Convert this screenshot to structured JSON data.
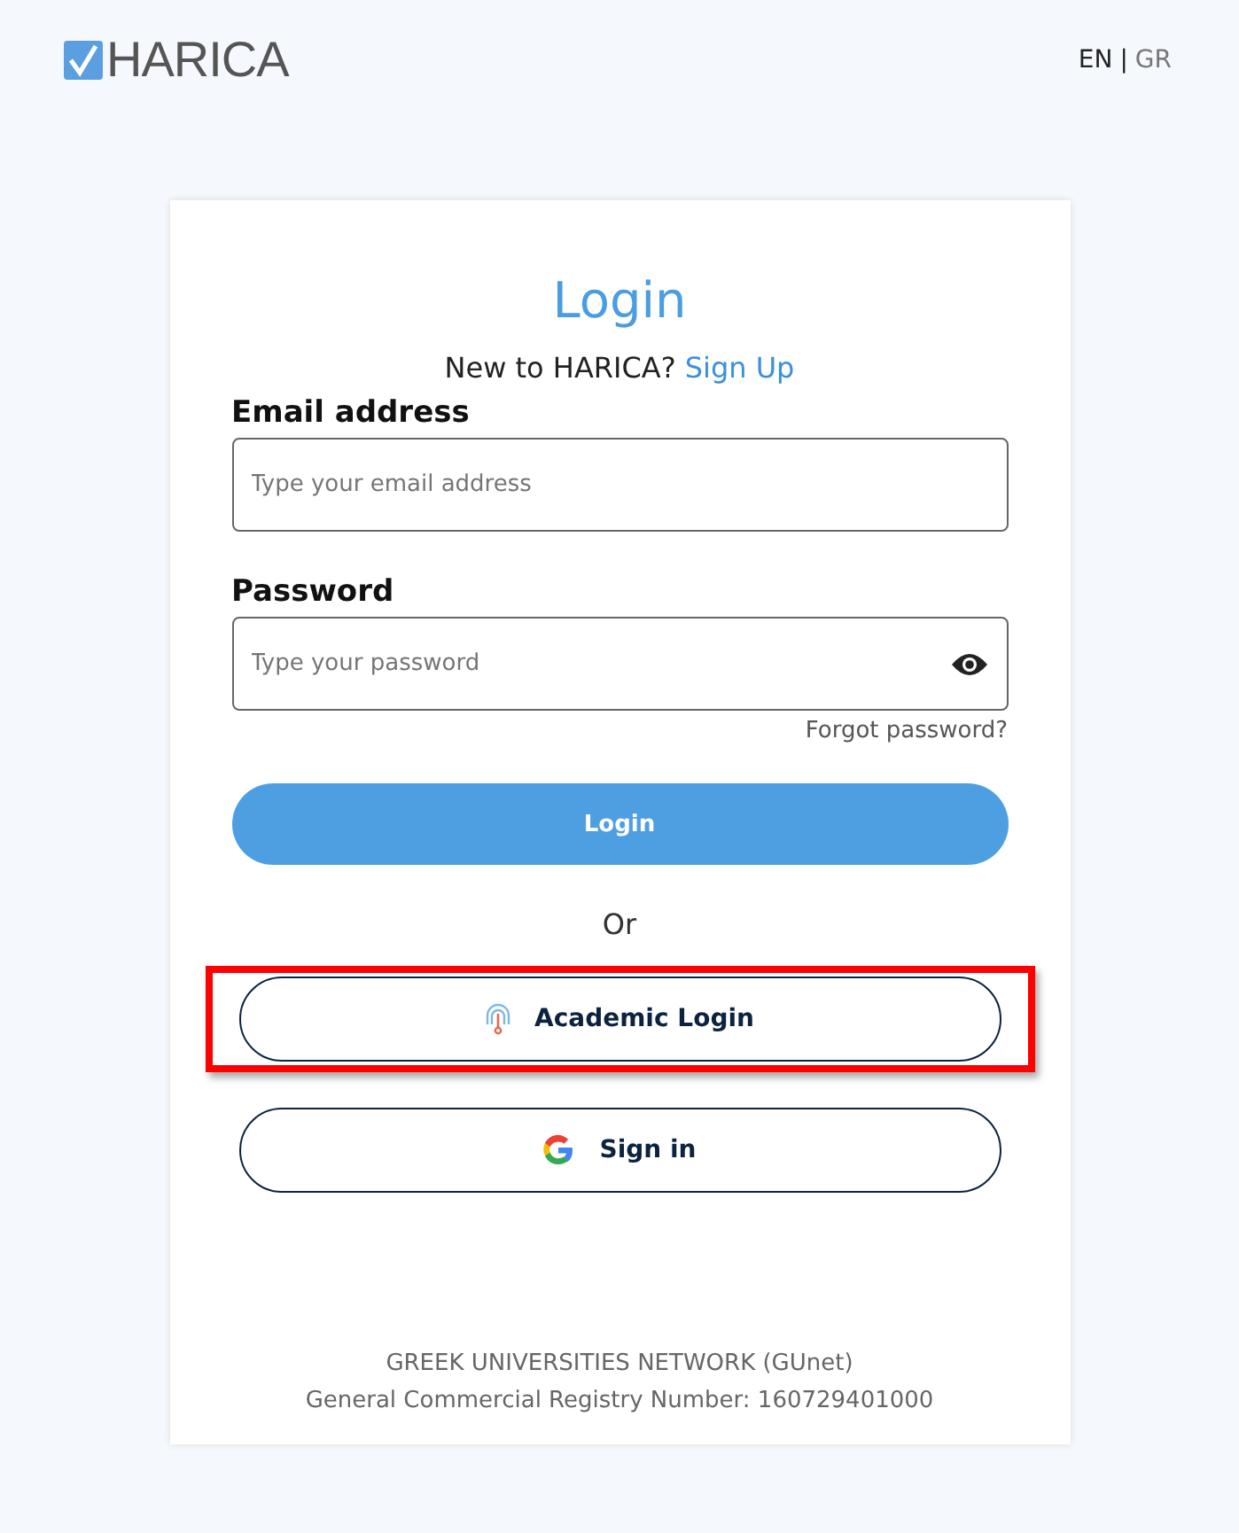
{
  "logo": {
    "text": "HARICA"
  },
  "languages": [
    {
      "label": "EN",
      "selected": true
    },
    {
      "label": "GR",
      "selected": false
    }
  ],
  "language_separator": "|",
  "title": "Login",
  "signup_prompt": {
    "text": "New to HARICA?",
    "link": "Sign Up"
  },
  "email": {
    "label": "Email address",
    "placeholder": "Type your email address"
  },
  "password": {
    "label": "Password",
    "placeholder": "Type your password"
  },
  "forgot_link": "Forgot password?",
  "login_button": "Login",
  "divider_text": "Or",
  "alt_logins": [
    {
      "kind": "academic",
      "label": "Academic Login",
      "highlighted": true
    },
    {
      "kind": "google",
      "label": "Sign in",
      "highlighted": false
    }
  ],
  "footer": [
    "GREEK UNIVERSITIES NETWORK (GUnet)",
    "General Commercial Registry Number: 160729401000"
  ]
}
